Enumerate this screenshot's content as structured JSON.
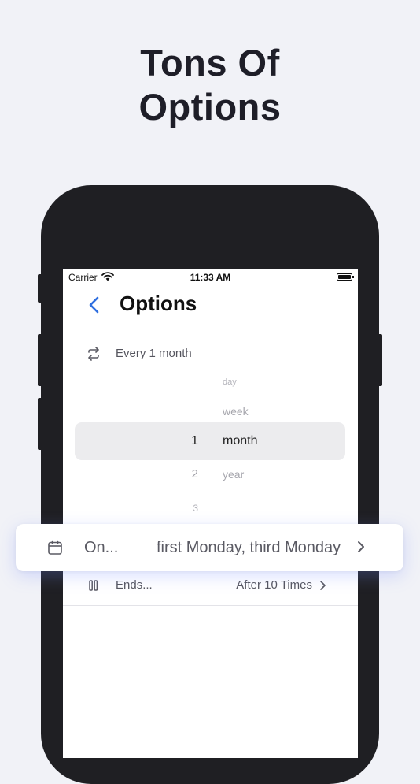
{
  "headline": {
    "line1": "Tons Of",
    "line2": "Options"
  },
  "status_bar": {
    "carrier": "Carrier",
    "time": "11:33 AM"
  },
  "nav": {
    "title": "Options",
    "back_icon": "chevron-left-icon"
  },
  "repeat": {
    "text": "Every 1 month",
    "icon": "repeat-icon"
  },
  "picker": {
    "numbers": [
      "1",
      "2",
      "3"
    ],
    "units": [
      "day",
      "week",
      "month",
      "year"
    ],
    "selected_number": "1",
    "selected_unit": "month"
  },
  "on_card": {
    "label": "On...",
    "value": "first Monday, third Monday",
    "icon": "calendar-icon"
  },
  "ends": {
    "label": "Ends...",
    "value": "After 10 Times",
    "icon": "pause-icon"
  },
  "colors": {
    "accent": "#2f6fe0",
    "background": "#f1f2f7",
    "phone": "#1f1f23"
  }
}
